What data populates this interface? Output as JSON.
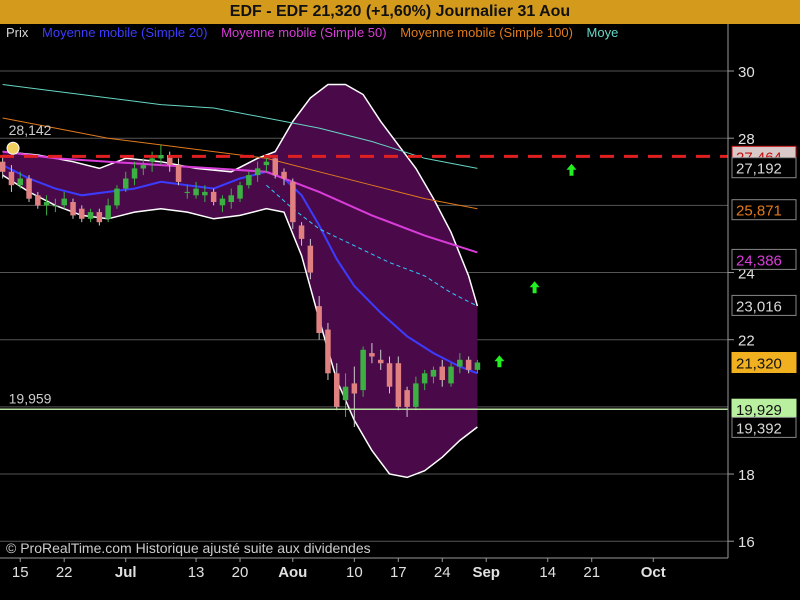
{
  "header": {
    "title": "EDF - EDF     21,320 (+1,60%)     Journalier  31 Aou"
  },
  "legend": [
    {
      "label": "Prix",
      "color": "#d8d8d8"
    },
    {
      "label": "Moyenne mobile (Simple 20)",
      "color": "#3c3cff"
    },
    {
      "label": "Moyenne mobile (Simple 50)",
      "color": "#d93cd9"
    },
    {
      "label": "Moyenne mobile (Simple 100)",
      "color": "#e07a1c"
    },
    {
      "label": "Moye",
      "color": "#66d6c4"
    }
  ],
  "footer": {
    "copyright": "© ProRealTime.com Historique ajusté suite aux dividendes"
  },
  "chart_data": {
    "type": "candlestick",
    "title": "EDF - EDF     21,320 (+1,60%)     Journalier  31 Aou",
    "xlabel": "",
    "ylabel": "",
    "ylim": [
      15.5,
      31.4
    ],
    "y_scale": "linear",
    "y_ticks": [
      16,
      18,
      20,
      22,
      24,
      26,
      28,
      30
    ],
    "x_ticks": [
      {
        "label": "15",
        "day": 2
      },
      {
        "label": "22",
        "day": 7
      },
      {
        "label": "Jul",
        "day": 14,
        "bold": true
      },
      {
        "label": "13",
        "day": 22
      },
      {
        "label": "20",
        "day": 27
      },
      {
        "label": "Aou",
        "day": 33,
        "bold": true
      },
      {
        "label": "10",
        "day": 40
      },
      {
        "label": "17",
        "day": 45
      },
      {
        "label": "24",
        "day": 50
      },
      {
        "label": "Sep",
        "day": 55,
        "bold": true
      },
      {
        "label": "14",
        "day": 62
      },
      {
        "label": "21",
        "day": 67
      },
      {
        "label": "Oct",
        "day": 74,
        "bold": true
      }
    ],
    "x_range": [
      -0.3,
      82.5
    ],
    "colors": {
      "up": "#3cb043",
      "down": "#e08080",
      "upWick": "#3cb043",
      "downWick": "#cccccc"
    },
    "candles": [
      {
        "d": 0,
        "o": 27.3,
        "h": 27.5,
        "l": 26.8,
        "c": 27.0
      },
      {
        "d": 1,
        "o": 27.0,
        "h": 27.2,
        "l": 26.4,
        "c": 26.6
      },
      {
        "d": 2,
        "o": 26.6,
        "h": 27.0,
        "l": 26.5,
        "c": 26.8
      },
      {
        "d": 3,
        "o": 26.8,
        "h": 26.9,
        "l": 26.1,
        "c": 26.2
      },
      {
        "d": 4,
        "o": 26.3,
        "h": 26.4,
        "l": 25.9,
        "c": 26.0
      },
      {
        "d": 5,
        "o": 26.0,
        "h": 26.3,
        "l": 25.7,
        "c": 26.1
      },
      {
        "d": 6,
        "o": 26.0,
        "h": 26.2,
        "l": 25.8,
        "c": 26.0
      },
      {
        "d": 7,
        "o": 26.0,
        "h": 26.4,
        "l": 25.9,
        "c": 26.2
      },
      {
        "d": 8,
        "o": 26.1,
        "h": 26.2,
        "l": 25.6,
        "c": 25.7
      },
      {
        "d": 9,
        "o": 25.9,
        "h": 26.0,
        "l": 25.5,
        "c": 25.6
      },
      {
        "d": 10,
        "o": 25.6,
        "h": 25.9,
        "l": 25.5,
        "c": 25.8
      },
      {
        "d": 11,
        "o": 25.8,
        "h": 25.9,
        "l": 25.4,
        "c": 25.5
      },
      {
        "d": 12,
        "o": 25.6,
        "h": 26.2,
        "l": 25.5,
        "c": 26.0
      },
      {
        "d": 13,
        "o": 26.0,
        "h": 26.6,
        "l": 25.9,
        "c": 26.5
      },
      {
        "d": 14,
        "o": 26.5,
        "h": 27.0,
        "l": 26.4,
        "c": 26.8
      },
      {
        "d": 15,
        "o": 26.8,
        "h": 27.3,
        "l": 26.6,
        "c": 27.1
      },
      {
        "d": 16,
        "o": 27.1,
        "h": 27.4,
        "l": 26.9,
        "c": 27.2
      },
      {
        "d": 17,
        "o": 27.3,
        "h": 27.6,
        "l": 27.0,
        "c": 27.4
      },
      {
        "d": 18,
        "o": 27.4,
        "h": 27.8,
        "l": 27.2,
        "c": 27.5
      },
      {
        "d": 19,
        "o": 27.5,
        "h": 27.6,
        "l": 27.0,
        "c": 27.2
      },
      {
        "d": 20,
        "o": 27.2,
        "h": 27.4,
        "l": 26.6,
        "c": 26.7
      },
      {
        "d": 21,
        "o": 26.4,
        "h": 26.6,
        "l": 26.2,
        "c": 26.4
      },
      {
        "d": 22,
        "o": 26.3,
        "h": 26.7,
        "l": 26.2,
        "c": 26.5
      },
      {
        "d": 23,
        "o": 26.3,
        "h": 26.6,
        "l": 26.1,
        "c": 26.4
      },
      {
        "d": 24,
        "o": 26.4,
        "h": 26.5,
        "l": 26.0,
        "c": 26.1
      },
      {
        "d": 25,
        "o": 26.0,
        "h": 26.3,
        "l": 25.8,
        "c": 26.2
      },
      {
        "d": 26,
        "o": 26.1,
        "h": 26.5,
        "l": 25.9,
        "c": 26.3
      },
      {
        "d": 27,
        "o": 26.2,
        "h": 26.7,
        "l": 26.1,
        "c": 26.6
      },
      {
        "d": 28,
        "o": 26.6,
        "h": 27.0,
        "l": 26.5,
        "c": 26.9
      },
      {
        "d": 29,
        "o": 26.9,
        "h": 27.3,
        "l": 26.7,
        "c": 27.1
      },
      {
        "d": 30,
        "o": 27.2,
        "h": 27.5,
        "l": 27.0,
        "c": 27.3
      },
      {
        "d": 31,
        "o": 27.4,
        "h": 27.5,
        "l": 26.8,
        "c": 26.9
      },
      {
        "d": 32,
        "o": 27.0,
        "h": 27.1,
        "l": 26.6,
        "c": 26.8
      },
      {
        "d": 33,
        "o": 26.7,
        "h": 26.8,
        "l": 25.3,
        "c": 25.5
      },
      {
        "d": 34,
        "o": 25.4,
        "h": 25.5,
        "l": 24.8,
        "c": 25.0
      },
      {
        "d": 35,
        "o": 24.8,
        "h": 25.0,
        "l": 23.8,
        "c": 24.0
      },
      {
        "d": 36,
        "o": 23.0,
        "h": 23.3,
        "l": 22.0,
        "c": 22.2
      },
      {
        "d": 37,
        "o": 22.3,
        "h": 22.5,
        "l": 20.8,
        "c": 21.0
      },
      {
        "d": 38,
        "o": 21.0,
        "h": 21.3,
        "l": 19.9,
        "c": 20.0
      },
      {
        "d": 39,
        "o": 20.2,
        "h": 21.0,
        "l": 19.7,
        "c": 20.6
      },
      {
        "d": 40,
        "o": 20.7,
        "h": 21.2,
        "l": 19.4,
        "c": 20.4
      },
      {
        "d": 41,
        "o": 20.5,
        "h": 21.8,
        "l": 20.3,
        "c": 21.7
      },
      {
        "d": 42,
        "o": 21.6,
        "h": 21.9,
        "l": 21.3,
        "c": 21.5
      },
      {
        "d": 43,
        "o": 21.4,
        "h": 21.7,
        "l": 21.1,
        "c": 21.3
      },
      {
        "d": 44,
        "o": 21.3,
        "h": 21.5,
        "l": 20.4,
        "c": 20.6
      },
      {
        "d": 45,
        "o": 21.3,
        "h": 21.5,
        "l": 19.9,
        "c": 20.0
      },
      {
        "d": 46,
        "o": 20.5,
        "h": 20.6,
        "l": 19.7,
        "c": 20.0
      },
      {
        "d": 47,
        "o": 20.0,
        "h": 20.9,
        "l": 19.9,
        "c": 20.7
      },
      {
        "d": 48,
        "o": 20.7,
        "h": 21.1,
        "l": 20.5,
        "c": 21.0
      },
      {
        "d": 49,
        "o": 20.9,
        "h": 21.2,
        "l": 20.7,
        "c": 21.1
      },
      {
        "d": 50,
        "o": 21.2,
        "h": 21.4,
        "l": 20.6,
        "c": 20.8
      },
      {
        "d": 51,
        "o": 20.7,
        "h": 21.3,
        "l": 20.6,
        "c": 21.2
      },
      {
        "d": 52,
        "o": 21.2,
        "h": 21.6,
        "l": 21.0,
        "c": 21.4
      },
      {
        "d": 53,
        "o": 21.4,
        "h": 21.5,
        "l": 21.0,
        "c": 21.1
      },
      {
        "d": 54,
        "o": 21.1,
        "h": 21.4,
        "l": 21.0,
        "c": 21.32
      }
    ],
    "series": [
      {
        "name": "Moyenne mobile (Simple 20)",
        "color": "#3c3cff",
        "width": 2,
        "dash": "",
        "points": [
          [
            0,
            27.2
          ],
          [
            3,
            26.8
          ],
          [
            6,
            26.5
          ],
          [
            9,
            26.3
          ],
          [
            12,
            26.4
          ],
          [
            15,
            26.5
          ],
          [
            18,
            26.7
          ],
          [
            21,
            26.6
          ],
          [
            24,
            26.5
          ],
          [
            27,
            26.8
          ],
          [
            30,
            27.0
          ],
          [
            32,
            26.8
          ],
          [
            34,
            26.3
          ],
          [
            36,
            25.4
          ],
          [
            38,
            24.4
          ],
          [
            40,
            23.6
          ],
          [
            43,
            22.8
          ],
          [
            46,
            22.1
          ],
          [
            49,
            21.6
          ],
          [
            52,
            21.2
          ],
          [
            54,
            21.0
          ]
        ]
      },
      {
        "name": "Moyenne mobile (Simple 50)",
        "color": "#d93cd9",
        "width": 2,
        "dash": "",
        "points": [
          [
            0,
            27.6
          ],
          [
            6,
            27.4
          ],
          [
            12,
            27.3
          ],
          [
            18,
            27.2
          ],
          [
            24,
            27.1
          ],
          [
            30,
            27.0
          ],
          [
            36,
            26.4
          ],
          [
            42,
            25.7
          ],
          [
            48,
            25.1
          ],
          [
            54,
            24.6
          ]
        ]
      },
      {
        "name": "Moyenne mobile (Simple 100)",
        "color": "#e07a1c",
        "width": 1,
        "dash": "",
        "points": [
          [
            0,
            28.6
          ],
          [
            6,
            28.3
          ],
          [
            12,
            28.0
          ],
          [
            18,
            27.8
          ],
          [
            24,
            27.6
          ],
          [
            30,
            27.4
          ],
          [
            36,
            27.0
          ],
          [
            42,
            26.6
          ],
          [
            48,
            26.2
          ],
          [
            54,
            25.9
          ]
        ]
      },
      {
        "name": "Moye",
        "color": "#66d6c4",
        "width": 1,
        "dash": "",
        "points": [
          [
            0,
            29.6
          ],
          [
            6,
            29.4
          ],
          [
            12,
            29.2
          ],
          [
            18,
            29.0
          ],
          [
            24,
            28.9
          ],
          [
            30,
            28.6
          ],
          [
            36,
            28.3
          ],
          [
            42,
            27.9
          ],
          [
            48,
            27.4
          ],
          [
            54,
            27.1
          ]
        ]
      },
      {
        "name": "",
        "color": "#33c7ff",
        "width": 1,
        "dash": "4,3",
        "points": [
          [
            30,
            26.6
          ],
          [
            33,
            25.9
          ],
          [
            36,
            25.3
          ],
          [
            40,
            24.8
          ],
          [
            44,
            24.3
          ],
          [
            48,
            23.9
          ],
          [
            51,
            23.4
          ],
          [
            54,
            23.0
          ]
        ]
      }
    ],
    "band": {
      "fill": "#4a0a4a",
      "stroke": "#ffffff",
      "upper": [
        [
          0,
          27.6
        ],
        [
          4,
          27.5
        ],
        [
          8,
          27.3
        ],
        [
          11,
          27.1
        ],
        [
          14,
          27.4
        ],
        [
          18,
          27.3
        ],
        [
          22,
          27.1
        ],
        [
          26,
          27.0
        ],
        [
          29,
          27.4
        ],
        [
          31,
          27.6
        ],
        [
          33,
          28.5
        ],
        [
          35,
          29.2
        ],
        [
          37,
          29.6
        ],
        [
          39,
          29.6
        ],
        [
          41,
          29.3
        ],
        [
          43,
          28.5
        ],
        [
          45,
          27.8
        ],
        [
          47,
          27.1
        ],
        [
          49,
          26.2
        ],
        [
          51,
          25.2
        ],
        [
          53,
          23.9
        ],
        [
          54,
          23.0
        ]
      ],
      "lower": [
        [
          0,
          26.9
        ],
        [
          3,
          26.4
        ],
        [
          6,
          26.0
        ],
        [
          9,
          25.7
        ],
        [
          12,
          25.6
        ],
        [
          15,
          25.8
        ],
        [
          18,
          25.9
        ],
        [
          21,
          25.8
        ],
        [
          24,
          25.6
        ],
        [
          27,
          25.7
        ],
        [
          30,
          25.9
        ],
        [
          32,
          25.8
        ],
        [
          34,
          24.5
        ],
        [
          36,
          22.6
        ],
        [
          38,
          20.8
        ],
        [
          40,
          19.6
        ],
        [
          42,
          18.7
        ],
        [
          44,
          18.0
        ],
        [
          46,
          17.9
        ],
        [
          48,
          18.1
        ],
        [
          50,
          18.5
        ],
        [
          52,
          19.0
        ],
        [
          54,
          19.4
        ]
      ]
    },
    "hlines": [
      {
        "name": "resistance",
        "y": 27.46,
        "color": "#e02020",
        "dash": "14,10",
        "width": 3,
        "x0": -0.3,
        "x1": 82.5
      },
      {
        "name": "support",
        "y": 19.93,
        "color": "#b8e0a0",
        "dash": "",
        "width": 1.5,
        "x0": -0.3,
        "x1": 82.5
      }
    ],
    "plot_annotations": [
      {
        "text": "28,142",
        "x": 0,
        "y": 28.1
      },
      {
        "text": "19,959",
        "x": 0,
        "y": 20.1
      }
    ],
    "price_tags": [
      {
        "text": "27,464",
        "y": 27.46,
        "bg": "#d9c9c9",
        "fg": "#c01010",
        "border": "#c01010"
      },
      {
        "text": "27,192",
        "y": 27.12,
        "bg": "#000000",
        "fg": "#d8d8d8",
        "border": "#888888"
      },
      {
        "text": "25,871",
        "y": 25.87,
        "bg": "#000000",
        "fg": "#e07a1c",
        "border": "#888888"
      },
      {
        "text": "24,386",
        "y": 24.39,
        "bg": "#000000",
        "fg": "#d93cd9",
        "border": "#888888"
      },
      {
        "text": "23,016",
        "y": 23.02,
        "bg": "#000000",
        "fg": "#d8d8d8",
        "border": "#888888"
      },
      {
        "text": "21,320",
        "y": 21.32,
        "bg": "#f0b020",
        "fg": "#111111",
        "border": "#f0b020"
      },
      {
        "text": "19,929",
        "y": 19.93,
        "bg": "#b8f0a0",
        "fg": "#111111",
        "border": "#b8f0a0"
      },
      {
        "text": "19,392",
        "y": 19.39,
        "bg": "#000000",
        "fg": "#d8d8d8",
        "border": "#888888"
      }
    ],
    "arrows": [
      {
        "x": 64.7,
        "y": 27.06,
        "color": "#22ee22"
      },
      {
        "x": 60.5,
        "y": 23.56,
        "color": "#22ee22"
      },
      {
        "x": 56.5,
        "y": 21.36,
        "color": "#22ee22"
      }
    ],
    "bell_marker": {
      "x": 0.5,
      "y": 27.7
    }
  }
}
